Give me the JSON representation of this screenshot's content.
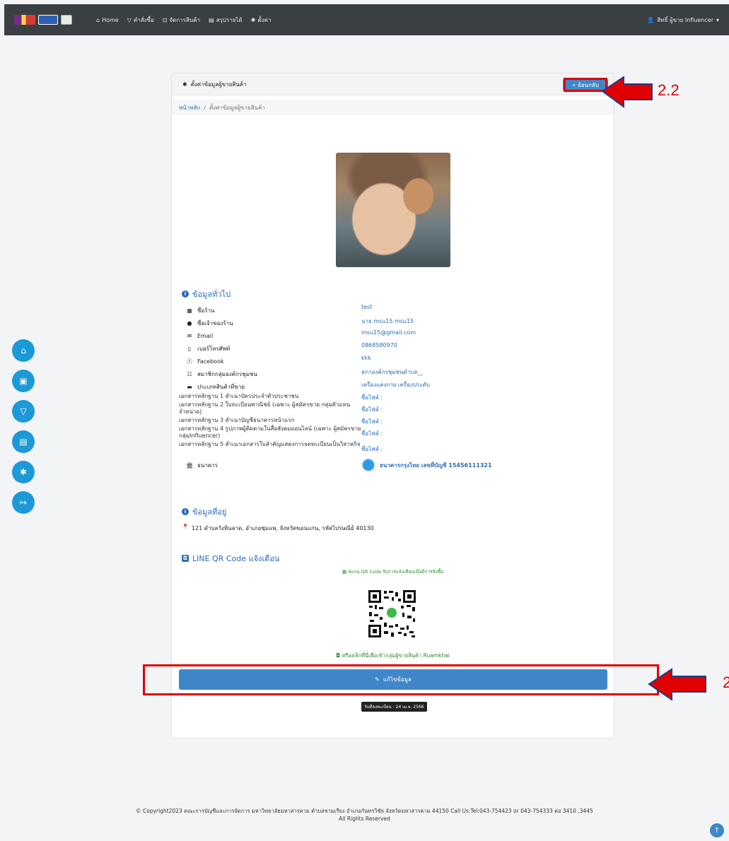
{
  "navbar": {
    "items": [
      {
        "icon": "home-icon",
        "label": "Home"
      },
      {
        "icon": "filter-icon",
        "label": "คำสั่งซื้อ"
      },
      {
        "icon": "box-icon",
        "label": "จัดการสินค้า"
      },
      {
        "icon": "document-icon",
        "label": "สรุปรายได้"
      },
      {
        "icon": "gear-icon",
        "label": "ตั้งค่า"
      }
    ],
    "user": "สิทธิ์ ผู้ขาย Influencer"
  },
  "card": {
    "header_title": "ตั้งค่าข้อมูลผู้ขายสินค้า",
    "back_button": "ย้อนกลับ",
    "breadcrumb": {
      "home": "หน้าหลัก",
      "sep": "/",
      "current": "ตั้งค่าข้อมูลผู้ขายสินค้า"
    }
  },
  "general": {
    "title": "ข้อมูลทั่วไป",
    "rows": [
      {
        "icon": "store-icon",
        "label": "ชื่อร้าน",
        "value": "test"
      },
      {
        "icon": "user-icon",
        "label": "ชื่อเจ้าของร้าน",
        "value": "นาย msu15 msu15"
      },
      {
        "icon": "envelope-icon",
        "label": "Email",
        "value": "msu15@gmail.com"
      },
      {
        "icon": "mobile-icon",
        "label": "เบอร์โทรศัพท์",
        "value": "0868580970"
      },
      {
        "icon": "facebook-icon",
        "label": "Facebook",
        "value": "kkk"
      },
      {
        "icon": "group-icon",
        "label": "สมาชิกกลุ่มองค์กรชุมชน",
        "value": "สภาองค์กรชุมชนตำบล__"
      },
      {
        "icon": "product-icon",
        "label": "ประเภทสินค้าที่ขาย",
        "value": "เครื่องแต่งกาย เครื่องประดับ"
      }
    ],
    "documents": [
      {
        "label": "เอกสารหลักฐาน 1 สำเนาบัตรประจำตัวประชาชน",
        "value": "ชื่อไฟล์ :"
      },
      {
        "label": "เอกสารหลักฐาน 2 ใบทะเบียนพาณิชย์ (เฉพาะ ผู้สมัครขาย กลุ่มตัวแทนจำหน่าย)",
        "value": "ชื่อไฟล์ :"
      },
      {
        "label": "เอกสารหลักฐาน 3 สำเนาบัญชีธนาคารหน้าแรก",
        "value": "ชื่อไฟล์ :"
      },
      {
        "label": "เอกสารหลักฐาน 4 รูปภาพผู้ติดตามในสื่อสังคมออนไลน์ (เฉพาะ ผู้สมัครขาย กลุ่มInfluencer)",
        "value": "ชื่อไฟล์ :"
      },
      {
        "label": "เอกสารหลักฐาน 5 สำเนาเอกสารใบสำคัญแสดงการจดทะเบียนเป็นวิสาหกิจ",
        "value": "ชื่อไฟล์ :"
      }
    ],
    "bank": {
      "label": "ธนาคาร",
      "value": "ธนาคารกรุงไทย เลขที่บัญชี 15456111321"
    }
  },
  "address": {
    "title": "ข้อมูลที่อยู่",
    "text": "121 ตำบลวังหินลาด, อำเภอชุมแพ, จังหวัดขอนแก่น, รหัสไปรษณีย์ 40130"
  },
  "line": {
    "title": "LINE QR Code แจ้งเตือน",
    "scan_text": "สแกน QR Code รับการแจ้งเตือนเมื่อมีการสั่งซื้อ",
    "link_text": "หรือคลิกที่นี่เพื่อเข้ากลุ่มผู้ขายสินค้า Ruamkhai"
  },
  "edit_button": "แก้ไขข้อมูล",
  "reg_date": "วันที่ลงทะเบียน : 24 เม.ย. 2566",
  "footer": {
    "line1": "© Copyright2023 คณะการบัญชีและการจัดการ มหาวิทยาลัยมหาสารคาม ตำบลขามเรียง อำเภอกันทรวิชัย จังหวัดมหาสารคาม 44150 Call Us:Tel:043-754423 or 043-754333 ต่อ 3410 ,3445",
    "line2": "All Rights Reserved"
  },
  "annotations": {
    "label_top": "2.2",
    "label_bottom": "2"
  },
  "colors": {
    "primary": "#3f87c9",
    "sidebar": "#1c9ad7",
    "navbar": "#3a3f44",
    "annotation": "#e10000"
  }
}
